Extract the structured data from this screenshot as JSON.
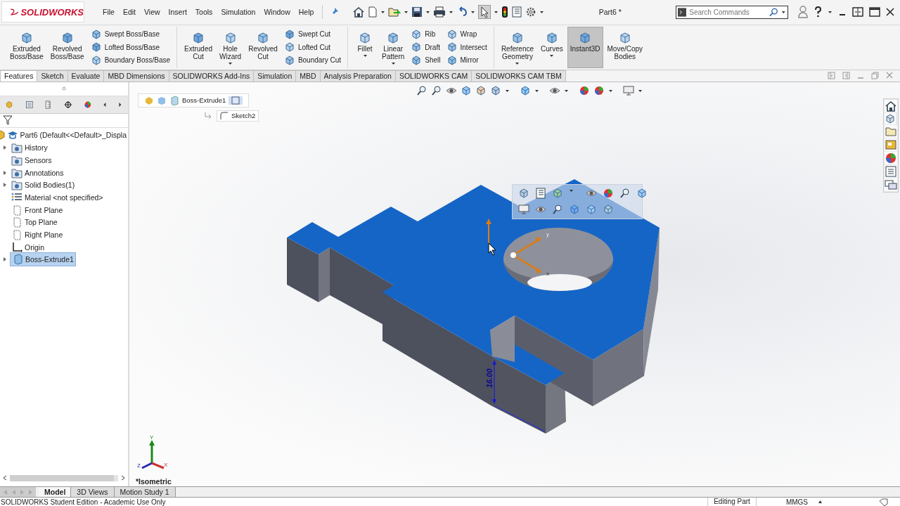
{
  "app": {
    "logo": "SOLIDWORKS",
    "menu": [
      "File",
      "Edit",
      "View",
      "Insert",
      "Tools",
      "Simulation",
      "Window",
      "Help"
    ],
    "title": "Part6 *",
    "search": {
      "placeholder": "Search Commands"
    }
  },
  "ribbon": {
    "groups": [
      {
        "items": [
          {
            "kind": "large",
            "label": "Extruded\nBoss/Base",
            "dropdown": false,
            "on": false
          },
          {
            "kind": "large",
            "label": "Revolved\nBoss/Base",
            "dropdown": false,
            "on": false
          },
          {
            "kind": "stack",
            "items": [
              "Swept Boss/Base",
              "Lofted Boss/Base",
              "Boundary Boss/Base"
            ]
          }
        ]
      },
      {
        "items": [
          {
            "kind": "large",
            "label": "Extruded\nCut",
            "dropdown": false,
            "on": false
          },
          {
            "kind": "large",
            "label": "Hole\nWizard",
            "dropdown": true,
            "on": false
          },
          {
            "kind": "large",
            "label": "Revolved\nCut",
            "dropdown": false,
            "on": false
          },
          {
            "kind": "stack",
            "items": [
              "Swept Cut",
              "Lofted Cut",
              "Boundary Cut"
            ]
          }
        ]
      },
      {
        "items": [
          {
            "kind": "large",
            "label": "Fillet",
            "dropdown": true,
            "on": false
          },
          {
            "kind": "large",
            "label": "Linear\nPattern",
            "dropdown": true,
            "on": false
          },
          {
            "kind": "stack",
            "items": [
              "Rib",
              "Draft",
              "Shell"
            ]
          },
          {
            "kind": "stack",
            "items": [
              "Wrap",
              "Intersect",
              "Mirror"
            ]
          }
        ]
      },
      {
        "items": [
          {
            "kind": "large",
            "label": "Reference\nGeometry",
            "dropdown": true,
            "on": false
          },
          {
            "kind": "large",
            "label": "Curves",
            "dropdown": true,
            "on": false
          },
          {
            "kind": "large",
            "label": "Instant3D",
            "dropdown": false,
            "on": true
          },
          {
            "kind": "large",
            "label": "Move/Copy\nBodies",
            "dropdown": false,
            "on": false
          }
        ]
      }
    ]
  },
  "tabs": [
    {
      "label": "Features",
      "selected": true
    },
    {
      "label": "Sketch",
      "selected": false
    },
    {
      "label": "Evaluate",
      "selected": false
    },
    {
      "label": "MBD Dimensions",
      "selected": false
    },
    {
      "label": "SOLIDWORKS Add-Ins",
      "selected": false
    },
    {
      "label": "Simulation",
      "selected": false
    },
    {
      "label": "MBD",
      "selected": false
    },
    {
      "label": "Analysis Preparation",
      "selected": false
    },
    {
      "label": "SOLIDWORKS CAM",
      "selected": false
    },
    {
      "label": "SOLIDWORKS CAM TBM",
      "selected": false
    }
  ],
  "tree": {
    "items": [
      {
        "kind": "part",
        "label": "Part6  (Default<<Default>_Displa",
        "expandable": false,
        "selected": false
      },
      {
        "kind": "folder",
        "label": "History",
        "expandable": true,
        "selected": false
      },
      {
        "kind": "folder",
        "label": "Sensors",
        "expandable": false,
        "selected": false
      },
      {
        "kind": "folder",
        "label": "Annotations",
        "expandable": true,
        "selected": false
      },
      {
        "kind": "folder",
        "label": "Solid Bodies(1)",
        "expandable": true,
        "selected": false
      },
      {
        "kind": "material",
        "label": "Material <not specified>",
        "expandable": false,
        "selected": false
      },
      {
        "kind": "plane",
        "label": "Front Plane",
        "expandable": false,
        "selected": false
      },
      {
        "kind": "plane",
        "label": "Top Plane",
        "expandable": false,
        "selected": false
      },
      {
        "kind": "plane",
        "label": "Right Plane",
        "expandable": false,
        "selected": false
      },
      {
        "kind": "origin",
        "label": "Origin",
        "expandable": false,
        "selected": false
      },
      {
        "kind": "feature",
        "label": "Boss-Extrude1",
        "expandable": true,
        "selected": true
      }
    ]
  },
  "breadcrumb": {
    "feature": "Boss-Extrude1",
    "sketch": "Sketch2"
  },
  "viewport": {
    "dimension": "16.00",
    "sketch_axes": [
      "y",
      "x"
    ],
    "triad": [
      "Y",
      "Z",
      "X"
    ],
    "view_name": "*Isometric"
  },
  "bottom_tabs": [
    {
      "label": "Model",
      "selected": true
    },
    {
      "label": "3D Views",
      "selected": false
    },
    {
      "label": "Motion Study 1",
      "selected": false
    }
  ],
  "status_bar": {
    "message": "SOLIDWORKS Student Edition - Academic Use Only",
    "mode": "Editing Part",
    "units": "MMGS"
  }
}
